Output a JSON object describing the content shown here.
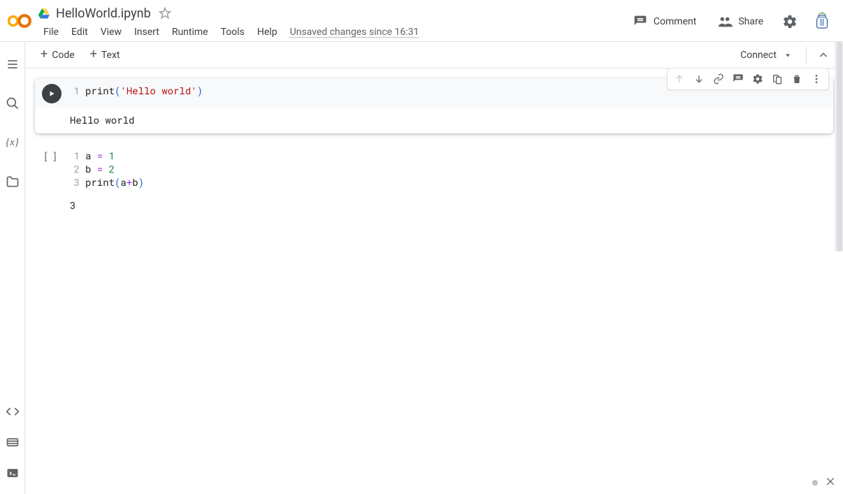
{
  "header": {
    "notebook_title": "HelloWorld.ipynb",
    "autosave": "Unsaved changes since 16:31",
    "comment_label": "Comment",
    "share_label": "Share"
  },
  "menu": {
    "file": "File",
    "edit": "Edit",
    "view": "View",
    "insert": "Insert",
    "runtime": "Runtime",
    "tools": "Tools",
    "help": "Help"
  },
  "toolbar": {
    "code_label": "Code",
    "text_label": "Text",
    "connect_label": "Connect"
  },
  "cells": [
    {
      "focused": true,
      "lines": [
        {
          "n": "1",
          "tokens": [
            {
              "t": "print",
              "cls": "tok-fn"
            },
            {
              "t": "(",
              "cls": "tok-par"
            },
            {
              "t": "'Hello world'",
              "cls": "tok-str"
            },
            {
              "t": ")",
              "cls": "tok-par"
            }
          ]
        }
      ],
      "output": "Hello world"
    },
    {
      "focused": false,
      "lines": [
        {
          "n": "1",
          "tokens": [
            {
              "t": "a ",
              "cls": "tok-var"
            },
            {
              "t": "=",
              "cls": "tok-op"
            },
            {
              "t": " ",
              "cls": "tok-var"
            },
            {
              "t": "1",
              "cls": "tok-num"
            }
          ]
        },
        {
          "n": "2",
          "tokens": [
            {
              "t": "b ",
              "cls": "tok-var"
            },
            {
              "t": "=",
              "cls": "tok-op"
            },
            {
              "t": " ",
              "cls": "tok-var"
            },
            {
              "t": "2",
              "cls": "tok-num"
            }
          ]
        },
        {
          "n": "3",
          "tokens": [
            {
              "t": "print",
              "cls": "tok-fn"
            },
            {
              "t": "(",
              "cls": "tok-par"
            },
            {
              "t": "a",
              "cls": "tok-var"
            },
            {
              "t": "+",
              "cls": "tok-op"
            },
            {
              "t": "b",
              "cls": "tok-var"
            },
            {
              "t": ")",
              "cls": "tok-par"
            }
          ]
        }
      ],
      "output": "3"
    }
  ]
}
